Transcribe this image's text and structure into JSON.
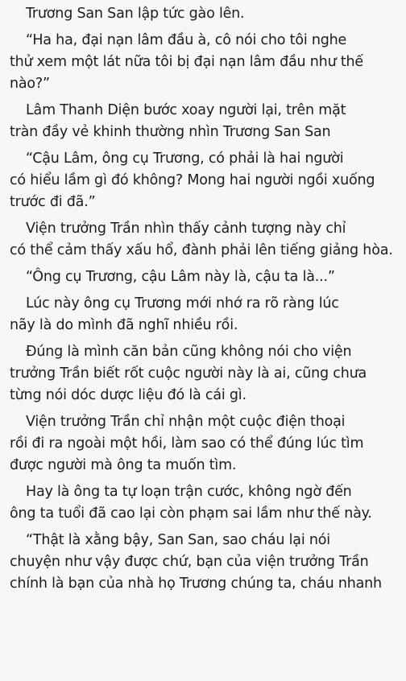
{
  "paragraphs": [
    [
      "Trương San San lập tức gào lên."
    ],
    [
      "“Ha ha, đại nạn lâm đầu à, cô nói cho tôi nghe",
      "thử xem một lát nữa tôi bị đại nạn lâm đầu như thế",
      "nào?”"
    ],
    [
      "Lâm Thanh Diện bước xoay người lại, trên mặt",
      "tràn đầy vẻ khinh thường nhìn Trương San San"
    ],
    [
      "“Cậu Lâm, ông cụ Trương, có phải là hai người",
      "có hiểu lầm gì đó không? Mong hai người ngồi xuống",
      "trước đi đã.”"
    ],
    [
      "Viện trưởng Trần nhìn thấy cảnh tượng này chỉ",
      "có thể cảm thấy xấu hổ, đành phải lên tiếng giảng hòa."
    ],
    [
      "“Ông cụ Trương, cậu Lâm này là, cậu ta là...”"
    ],
    [
      "Lúc này ông cụ Trương mới nhớ ra rõ ràng lúc",
      "nãy là do mình đã nghĩ nhiều rồi."
    ],
    [
      "Đúng là mình căn bản cũng không nói cho viện",
      "trưởng Trần biết rốt cuộc người này là ai, cũng chưa",
      "từng nói dóc dược liệu đó là cái gì."
    ],
    [
      "Viện trưởng Trần chỉ nhận một cuộc điện thoại",
      "rồi đi ra ngoài một hồi, làm sao có thể đúng lúc tìm",
      "được người mà ông ta muốn tìm."
    ],
    [
      "Hay là ông ta tự loạn trận cước, không ngờ đến",
      "ông ta tuổi đã cao lại còn phạm sai lầm như thế này."
    ],
    [
      "“Thật là xằng bậy, San San, sao cháu lại nói",
      "chuyện như vậy được chứ, bạn của viện trưởng Trần",
      "chính là bạn của nhà họ Trương chúng ta, cháu nhanh"
    ]
  ]
}
